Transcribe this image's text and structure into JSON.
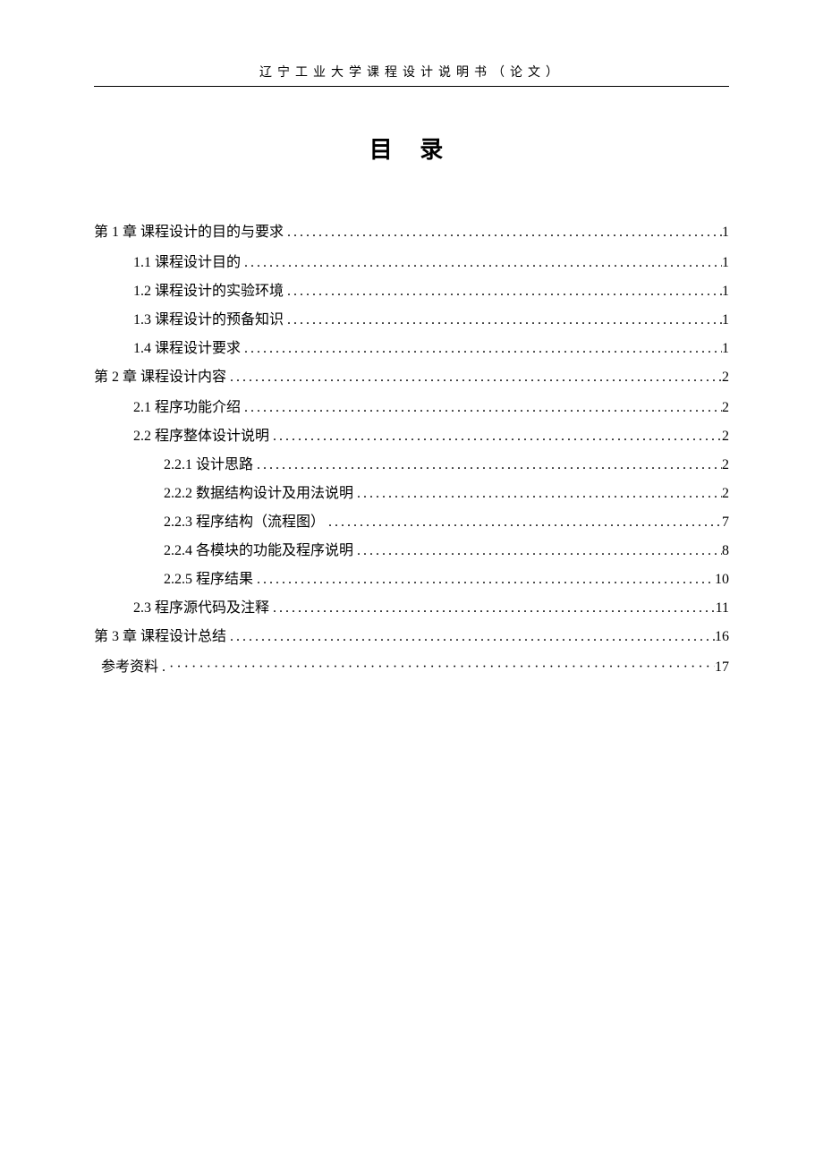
{
  "header": {
    "running_title": "辽宁工业大学课程设计说明书（论文）"
  },
  "toc": {
    "title": "目 录",
    "entries": [
      {
        "level": 0,
        "label": "第 1 章  课程设计的目的与要求",
        "page": "1",
        "style": "chapter"
      },
      {
        "level": 1,
        "label": "1.1 课程设计目的",
        "page": "1"
      },
      {
        "level": 1,
        "label": "1.2 课程设计的实验环境",
        "page": "1"
      },
      {
        "level": 1,
        "label": "1.3 课程设计的预备知识",
        "page": "1"
      },
      {
        "level": 1,
        "label": "1.4 课程设计要求",
        "page": "1"
      },
      {
        "level": 0,
        "label": "第 2 章  课程设计内容",
        "page": "2",
        "style": "chapter"
      },
      {
        "level": 1,
        "label": "2.1 程序功能介绍",
        "page": "2"
      },
      {
        "level": 1,
        "label": "2.2 程序整体设计说明",
        "page": "2"
      },
      {
        "level": 2,
        "label": "2.2.1 设计思路",
        "page": "2"
      },
      {
        "level": 2,
        "label": "2.2.2 数据结构设计及用法说明",
        "page": "2"
      },
      {
        "level": 2,
        "label": "2.2.3 程序结构（流程图）",
        "page": "7"
      },
      {
        "level": 2,
        "label": "2.2.4 各模块的功能及程序说明",
        "page": "8"
      },
      {
        "level": 2,
        "label": "2.2.5 程序结果",
        "page": "10"
      },
      {
        "level": 1,
        "label": "2.3 程序源代码及注释",
        "page": "11"
      },
      {
        "level": 0,
        "label": "第 3 章 课程设计总结",
        "page": "16",
        "style": "chapter"
      },
      {
        "level": 0,
        "label": "参考资料 .",
        "page": "17",
        "style": "refs"
      }
    ]
  }
}
